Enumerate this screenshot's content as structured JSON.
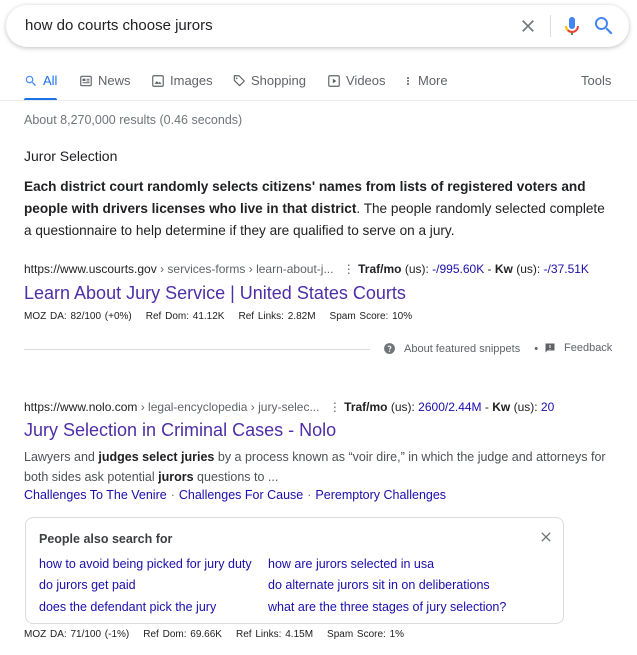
{
  "search": {
    "query": "how do courts choose jurors"
  },
  "tabs": [
    {
      "label": "All",
      "icon": "search-icon",
      "active": true
    },
    {
      "label": "News",
      "icon": "news-icon"
    },
    {
      "label": "Images",
      "icon": "image-icon"
    },
    {
      "label": "Shopping",
      "icon": "tag-icon"
    },
    {
      "label": "Videos",
      "icon": "play-icon"
    },
    {
      "label": "More",
      "icon": "more-vert-icon"
    }
  ],
  "tools_label": "Tools",
  "result_stats": "About 8,270,000 results (0.46 seconds)",
  "featured_snippet": {
    "heading": "Juror Selection",
    "bold_text": "Each district court randomly selects citizens' names from lists of registered voters and people with drivers licenses who live in that district",
    "rest_text": ". The people randomly selected complete a questionnaire to help determine if they are qualified to serve on a jury.",
    "about_label": "About featured snippets",
    "feedback_label": "Feedback"
  },
  "results": [
    {
      "domain": "https://www.uscourts.gov",
      "crumbs": " › services-forms › learn-about-j...",
      "traf_label": "Traf/mo",
      "traf_region": " (us): ",
      "traf_value": "-/995.60K",
      "kw_label": "Kw",
      "kw_region": " (us): ",
      "kw_value": "-/37.51K",
      "title": "Learn About Jury Service | United States Courts",
      "metrics": {
        "moz_da": "MOZ DA: 82/100 (+0%)",
        "ref_dom": "Ref Dom: 41.12K",
        "ref_links": "Ref Links: 2.82M",
        "spam_score": "Spam Score: 10%"
      }
    },
    {
      "domain": "https://www.nolo.com",
      "crumbs": " › legal-encyclopedia › jury-selec...",
      "traf_label": "Traf/mo",
      "traf_region": " (us): ",
      "traf_value": "2600/2.44M",
      "kw_label": "Kw",
      "kw_region": " (us): ",
      "kw_value": "20",
      "title": "Jury Selection in Criminal Cases - Nolo",
      "desc_parts": [
        {
          "t": "Lawyers and ",
          "b": false
        },
        {
          "t": "judges select juries",
          "b": true
        },
        {
          "t": " by a process known as “voir dire,” in which the judge and attorneys for both sides ask potential ",
          "b": false
        },
        {
          "t": "jurors",
          "b": true
        },
        {
          "t": " questions to ...",
          "b": false
        }
      ],
      "sitelinks": [
        "Challenges To The Venire",
        "Challenges For Cause",
        "Peremptory Challenges"
      ],
      "metrics": {
        "moz_da": "MOZ DA: 71/100 (-1%)",
        "ref_dom": "Ref Dom: 69.66K",
        "ref_links": "Ref Links: 4.15M",
        "spam_score": "Spam Score: 1%"
      }
    }
  ],
  "people_also_search": {
    "title": "People also search for",
    "items": [
      "how to avoid being picked for jury duty",
      "how are jurors selected in usa",
      "do jurors get paid",
      "do alternate jurors sit in on deliberations",
      "does the defendant pick the jury",
      "what are the three stages of jury selection?"
    ]
  },
  "colors": {
    "accent": "#1a73e8",
    "visited_link": "#4d2ea7",
    "link": "#1a0dab"
  }
}
